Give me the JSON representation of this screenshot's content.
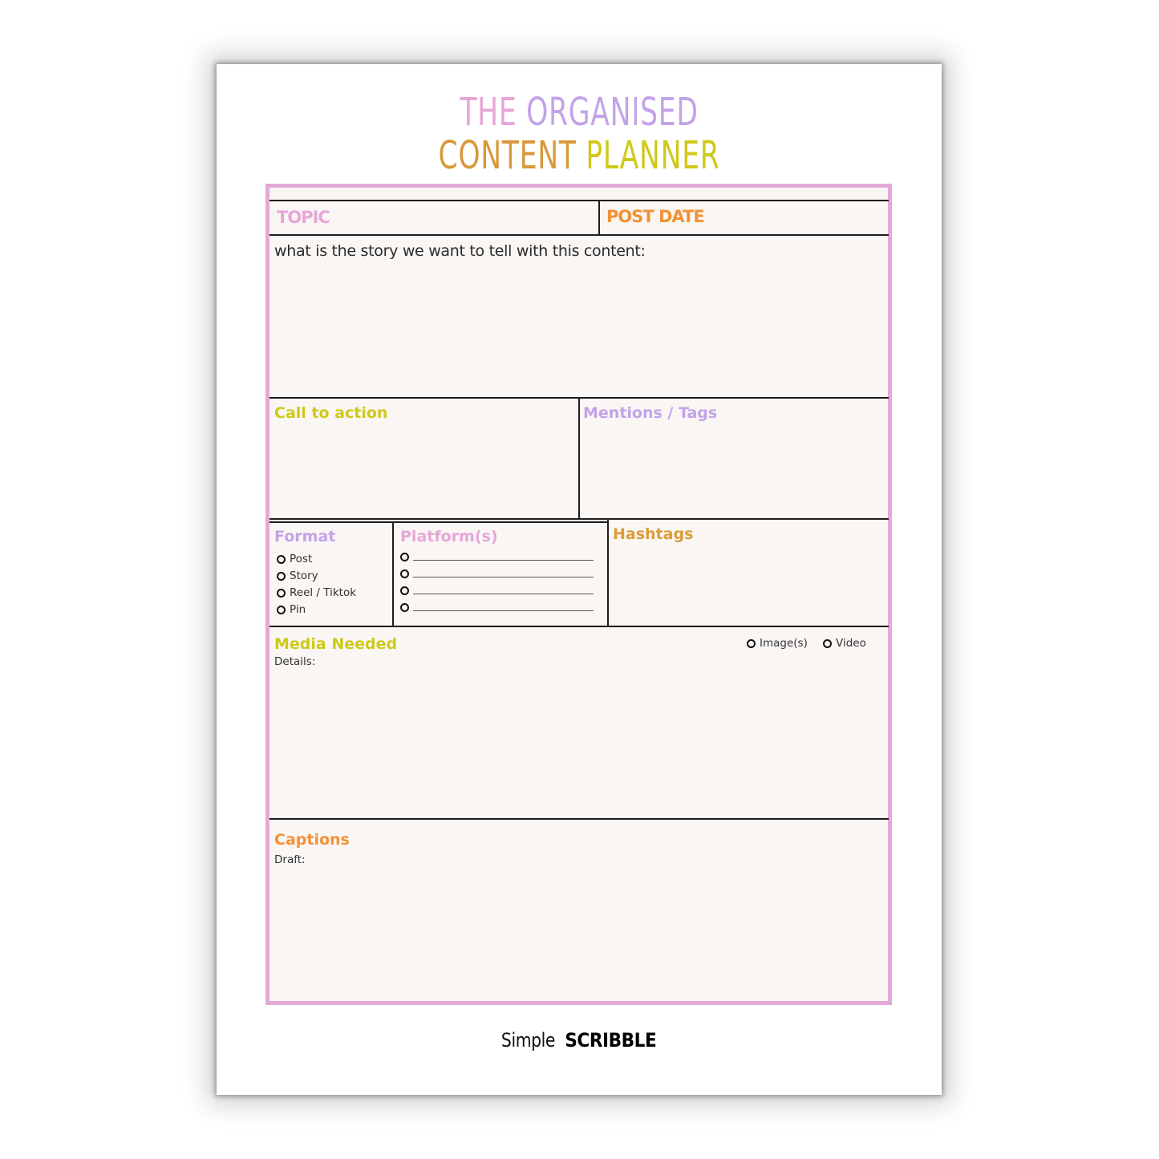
{
  "title": {
    "line1": [
      {
        "text": "THE",
        "color": "#e6a6d8"
      },
      {
        "text": "ORGANISED",
        "color": "#c3a3e8"
      }
    ],
    "line2": [
      {
        "text": "CONTENT",
        "color": "#d9983a"
      },
      {
        "text": "PLANNER",
        "color": "#cfc91a"
      }
    ]
  },
  "colors": {
    "frame": "#e5a8da",
    "paper": "#f9f6f4",
    "pink": "#e6a6d8",
    "lavender": "#c3a3e8",
    "orange": "#f29236",
    "mustard": "#dc9c37",
    "lime": "#cfc91a"
  },
  "sections": {
    "topic": {
      "label": "TOPIC"
    },
    "post_date": {
      "label": "POST DATE"
    },
    "story": {
      "prompt": "what is the story we want to tell with this content:"
    },
    "call_to_action": {
      "label": "Call to action"
    },
    "mentions": {
      "label": "Mentions / Tags"
    },
    "format": {
      "label": "Format",
      "options": [
        "Post",
        "Story",
        "Reel / Tiktok",
        "Pin"
      ]
    },
    "platforms": {
      "label": "Platform(s)",
      "blank_count": 4
    },
    "hashtags": {
      "label": "Hashtags"
    },
    "media": {
      "label": "Media Needed",
      "sub_label": "Details:",
      "options": [
        "Image(s)",
        "Video"
      ]
    },
    "captions": {
      "label": "Captions",
      "sub_label": "Draft:"
    }
  },
  "footer": {
    "brand_part1": "Simple",
    "brand_part2": "SCRIBBLE"
  }
}
